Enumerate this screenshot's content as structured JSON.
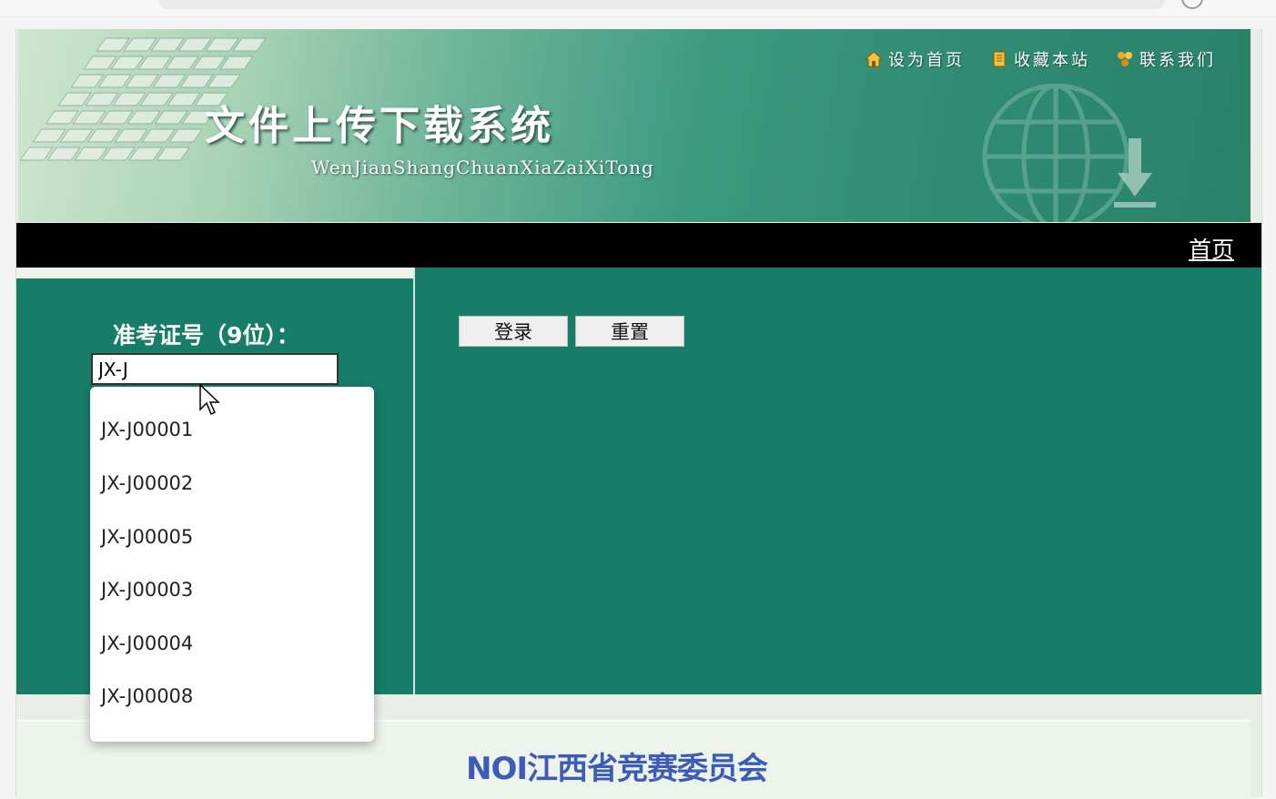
{
  "header": {
    "title": "文件上传下载系统",
    "subtitle": "WenJianShangChuanXiaZaiXiTong",
    "links": [
      {
        "label": "设为首页",
        "icon": "home-icon"
      },
      {
        "label": "收藏本站",
        "icon": "bookmark-icon"
      },
      {
        "label": "联系我们",
        "icon": "contact-icon"
      }
    ]
  },
  "nav": {
    "home": "首页"
  },
  "form": {
    "id_label": "准考证号（9位）：",
    "id_value": "JX-J",
    "login_label": "登录",
    "reset_label": "重置"
  },
  "autocomplete": {
    "items": [
      "JX-J00001",
      "JX-J00002",
      "JX-J00005",
      "JX-J00003",
      "JX-J00004",
      "JX-J00008"
    ]
  },
  "footer": {
    "text": "NOI江西省竞赛委员会"
  },
  "colors": {
    "panel": "#177d69",
    "navbar": "#000000",
    "footer_text": "#3d5bb8"
  }
}
